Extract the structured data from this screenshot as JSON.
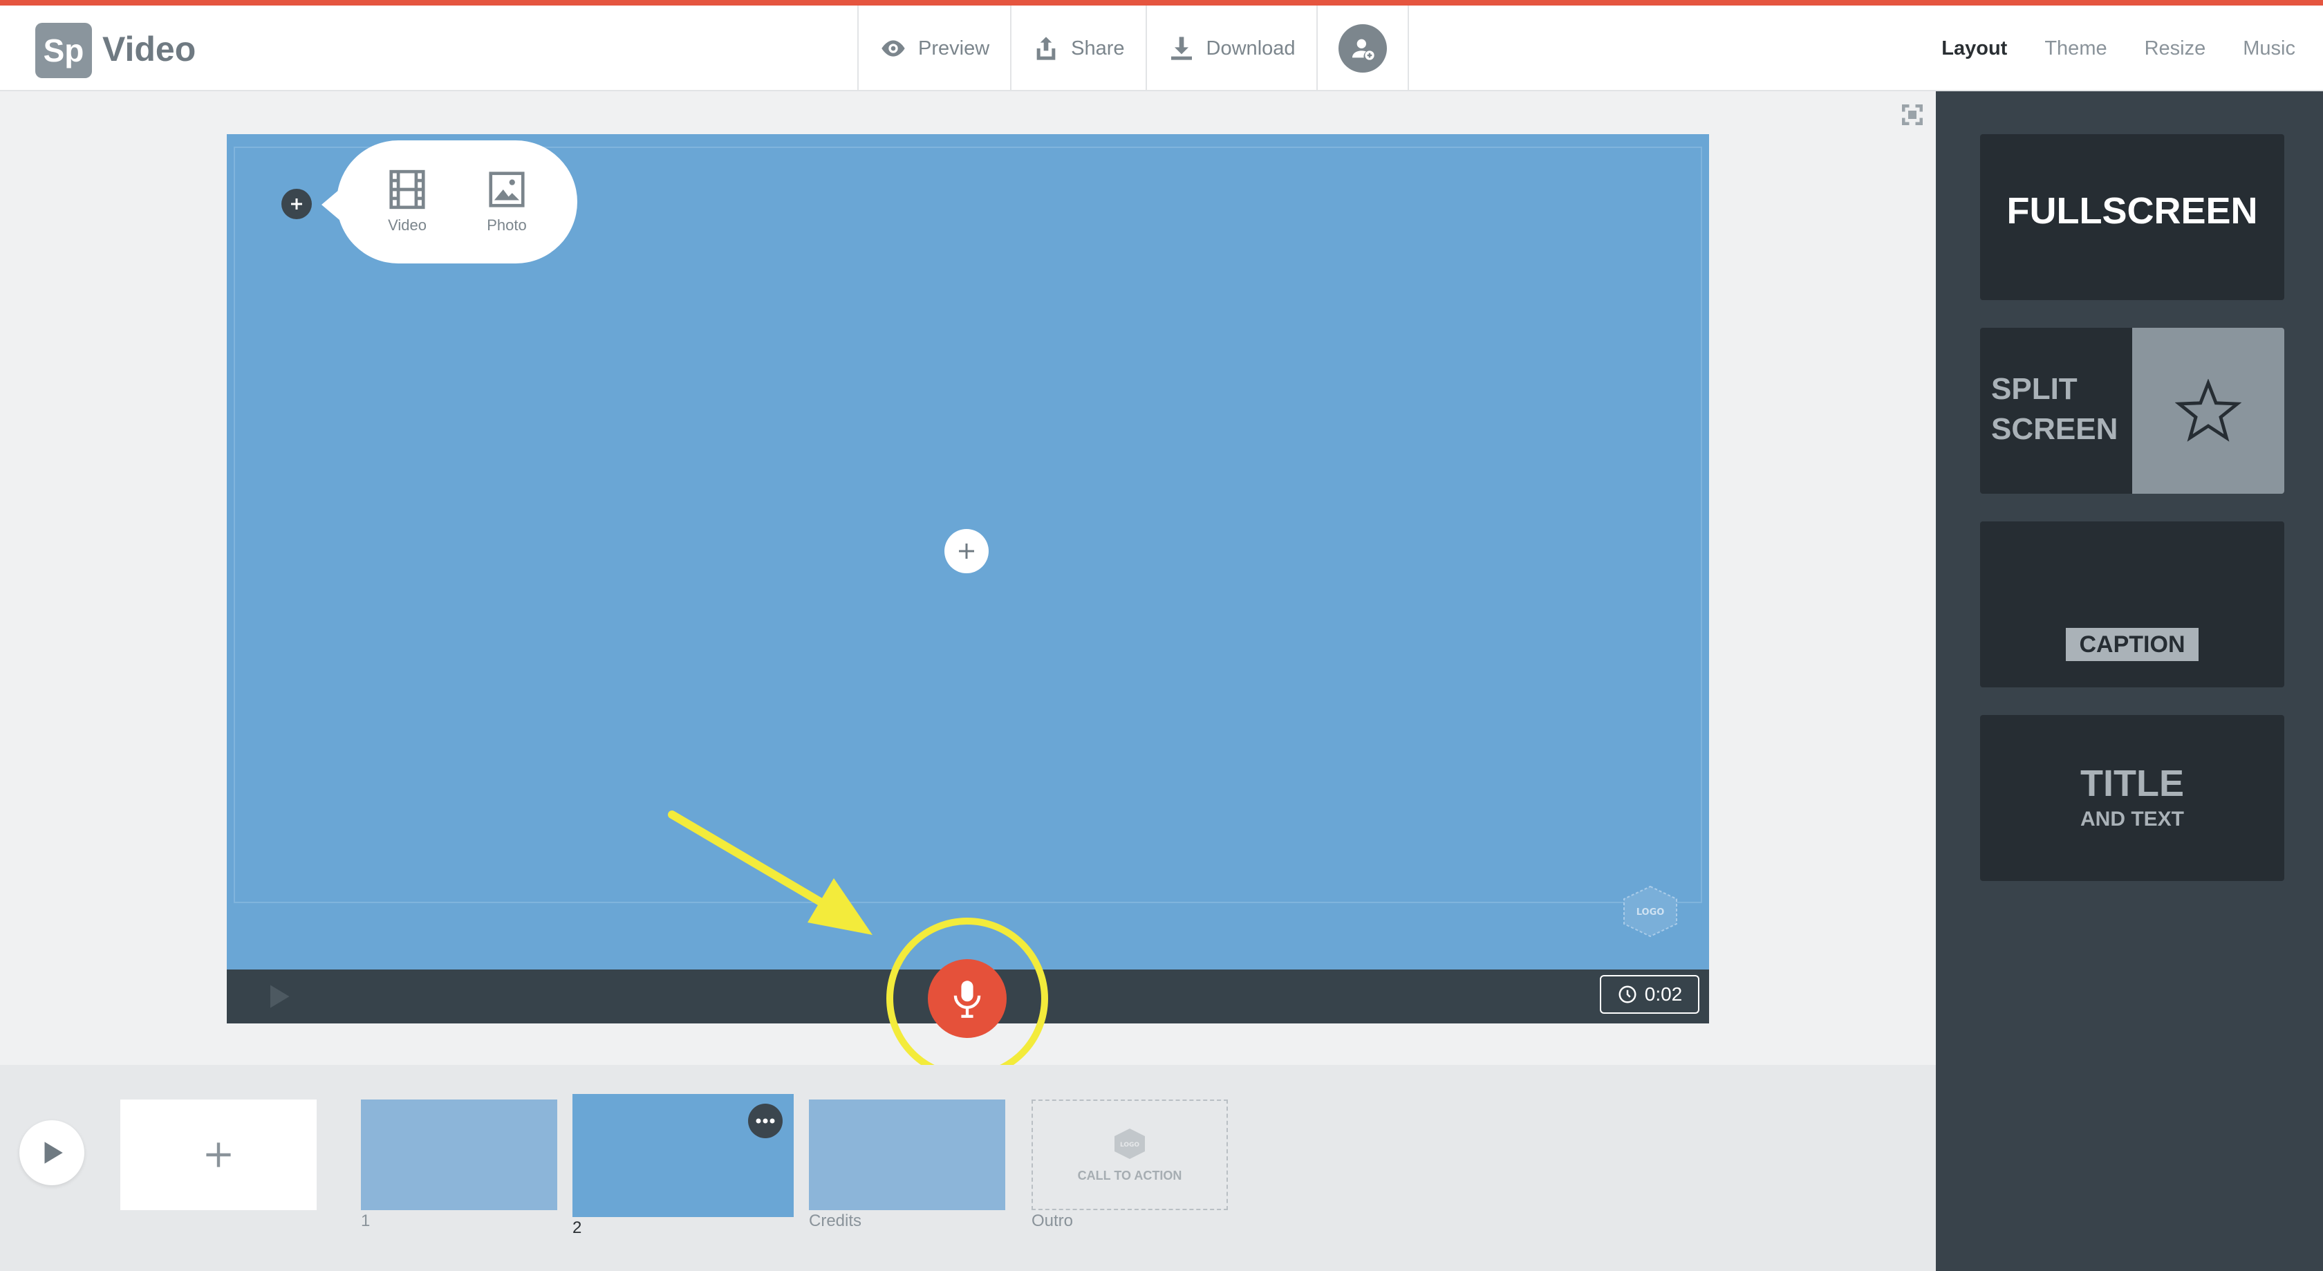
{
  "app": {
    "logo_text": "Sp",
    "name": "Video"
  },
  "toolbar": {
    "preview_label": "Preview",
    "share_label": "Share",
    "download_label": "Download",
    "avatar_icon": "add-user-icon"
  },
  "right_tabs": [
    {
      "label": "Layout",
      "active": true
    },
    {
      "label": "Theme",
      "active": false
    },
    {
      "label": "Resize",
      "active": false
    },
    {
      "label": "Music",
      "active": false
    }
  ],
  "canvas": {
    "background_color": "#6aa6d5",
    "add_menu": {
      "video_label": "Video",
      "photo_label": "Photo"
    },
    "logo_badge_text": "LOGO",
    "timer": "0:02"
  },
  "timeline": {
    "clips": [
      {
        "label": "1",
        "selected": false
      },
      {
        "label": "2",
        "selected": true
      },
      {
        "label": "Credits",
        "selected": false
      },
      {
        "label": "Outro",
        "selected": false
      }
    ],
    "outro_card_text": "CALL TO ACTION",
    "outro_logo_text": "LOGO"
  },
  "layouts": {
    "fullscreen": "FULLSCREEN",
    "split_line1": "SPLIT",
    "split_line2": "SCREEN",
    "caption": "CAPTION",
    "title_big": "TITLE",
    "title_small": "AND TEXT"
  },
  "colors": {
    "accent": "#e5553f",
    "mic": "#e5513a",
    "highlight": "#f3eb3b",
    "panel": "#39434b"
  }
}
